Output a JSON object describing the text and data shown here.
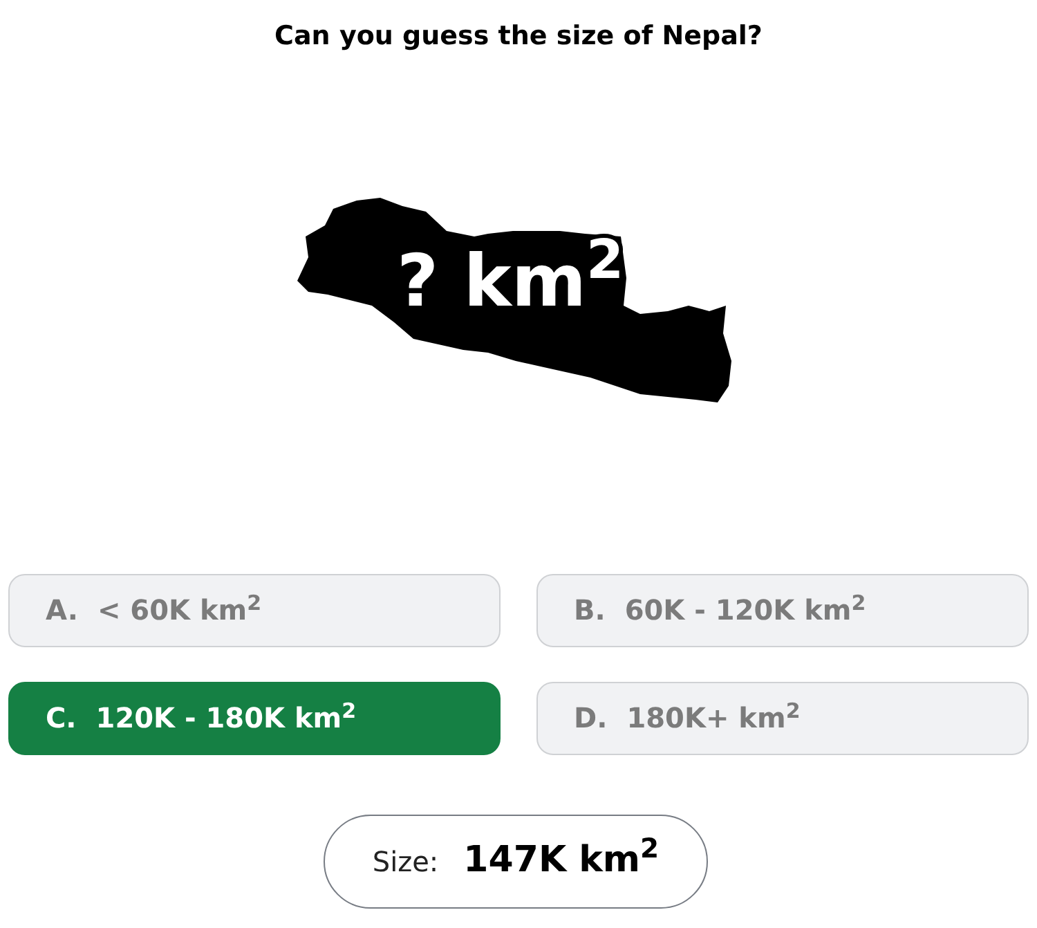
{
  "question": "Can you guess the size of Nepal?",
  "map_label": "? km$^{2}$",
  "options": [
    {
      "letter": "A.",
      "text": "< 60K km$^{2}$",
      "selected": false
    },
    {
      "letter": "B.",
      "text": "60K - 120K km$^{2}$",
      "selected": false
    },
    {
      "letter": "C.",
      "text": "120K - 180K km$^{2}$",
      "selected": true
    },
    {
      "letter": "D.",
      "text": "180K+ km$^{2}$",
      "selected": false
    }
  ],
  "answer": {
    "label": "Size:",
    "value": "147K km$^{2}$"
  }
}
